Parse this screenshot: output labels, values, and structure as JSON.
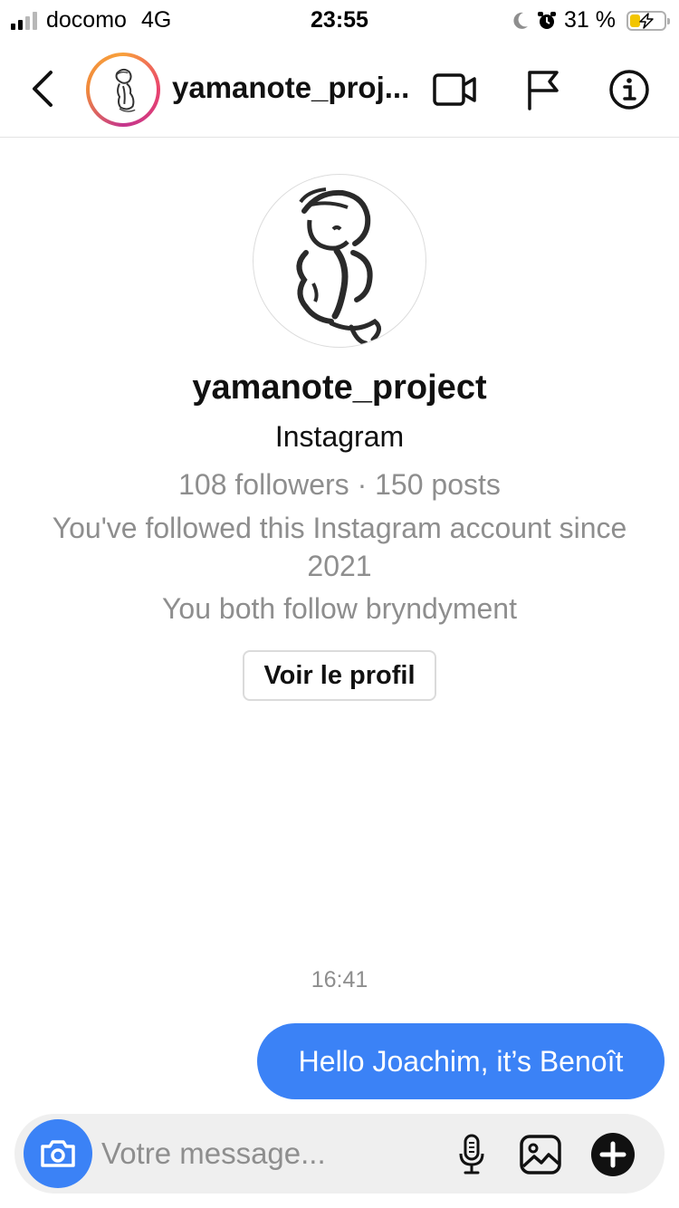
{
  "status_bar": {
    "carrier": "docomo",
    "network": "4G",
    "time": "23:55",
    "battery_text": "31 %",
    "battery_level": 0.31,
    "signal_bars_active": 2,
    "signal_bars_total": 4,
    "icons": [
      "moon-icon",
      "alarm-icon",
      "charging-bolt-icon"
    ]
  },
  "header": {
    "title": "yamanote_proj...",
    "icons": [
      "back-chevron-icon",
      "video-call-icon",
      "flag-icon",
      "info-icon"
    ]
  },
  "profile": {
    "username": "yamanote_project",
    "subtitle": "Instagram",
    "stats": "108 followers · 150 posts",
    "followed_since": "You've followed this Instagram account since 2021",
    "mutual": "You both follow bryndyment",
    "view_profile_label": "Voir le profil"
  },
  "thread": {
    "timestamp": "16:41",
    "messages": [
      {
        "text": "Hello Joachim, it’s Benoît",
        "sender": "me"
      }
    ]
  },
  "composer": {
    "placeholder": "Votre message...",
    "icons": [
      "camera-icon",
      "microphone-icon",
      "gallery-icon",
      "plus-icon"
    ]
  },
  "colors": {
    "accent": "#3b82f6",
    "muted_text": "#8e8e8e",
    "battery_fill": "#f2c500",
    "composer_bg": "#efefef"
  }
}
